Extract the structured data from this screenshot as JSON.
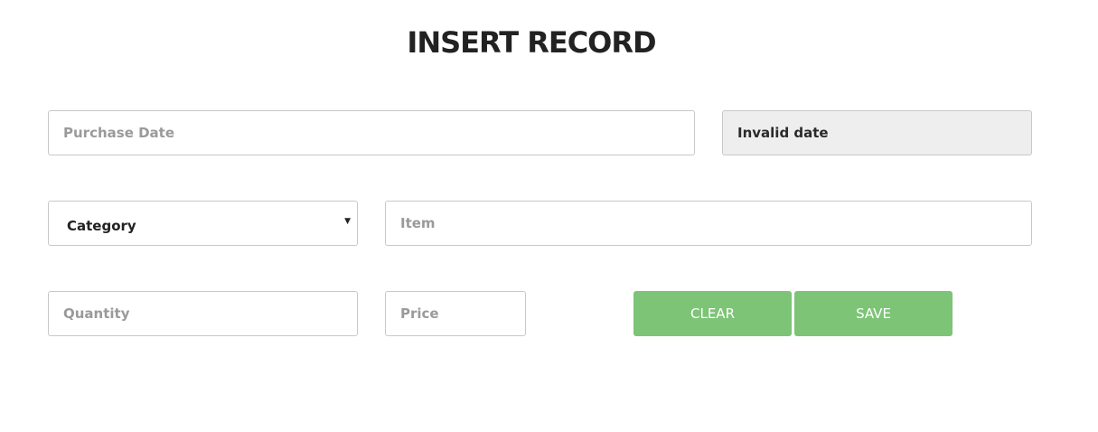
{
  "page": {
    "title": "INSERT RECORD"
  },
  "form": {
    "purchase_date": {
      "placeholder": "Purchase Date",
      "value": ""
    },
    "date_display": {
      "value": "Invalid date"
    },
    "category": {
      "selected": "Category"
    },
    "item": {
      "placeholder": "Item",
      "value": ""
    },
    "quantity": {
      "placeholder": "Quantity",
      "value": ""
    },
    "price": {
      "placeholder": "Price",
      "value": ""
    }
  },
  "actions": {
    "clear_label": "CLEAR",
    "save_label": "SAVE"
  },
  "colors": {
    "button_bg": "#7dc477",
    "readonly_bg": "#eeeeee"
  }
}
